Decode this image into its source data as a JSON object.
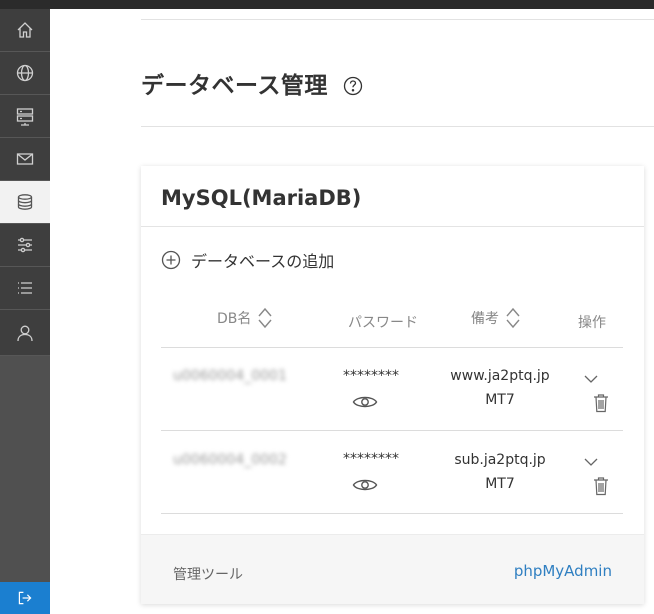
{
  "header": {
    "title": "データベース管理"
  },
  "panel": {
    "title": "MySQL(MariaDB)",
    "add_label": "データベースの追加",
    "columns": {
      "db_name": "DB名",
      "password": "パスワード",
      "note": "備考",
      "action": "操作"
    },
    "rows": [
      {
        "db_name": "u0060004_0001",
        "password": "********",
        "note_line1": "www.ja2ptq.jp",
        "note_line2": "MT7"
      },
      {
        "db_name": "u0060004_0002",
        "password": "********",
        "note_line1": "sub.ja2ptq.jp",
        "note_line2": "MT7"
      }
    ],
    "footer": {
      "label": "管理ツール",
      "link": "phpMyAdmin"
    }
  },
  "icons": {
    "sidebar": [
      "home-icon",
      "globe-icon",
      "server-icon",
      "mail-icon",
      "database-icon",
      "sliders-icon",
      "list-icon",
      "user-icon"
    ],
    "logout": "logout-icon"
  },
  "colors": {
    "sidebar_bg": "#3e3e3e",
    "accent_blue": "#1b7fd0",
    "link": "#2f7fc1"
  }
}
